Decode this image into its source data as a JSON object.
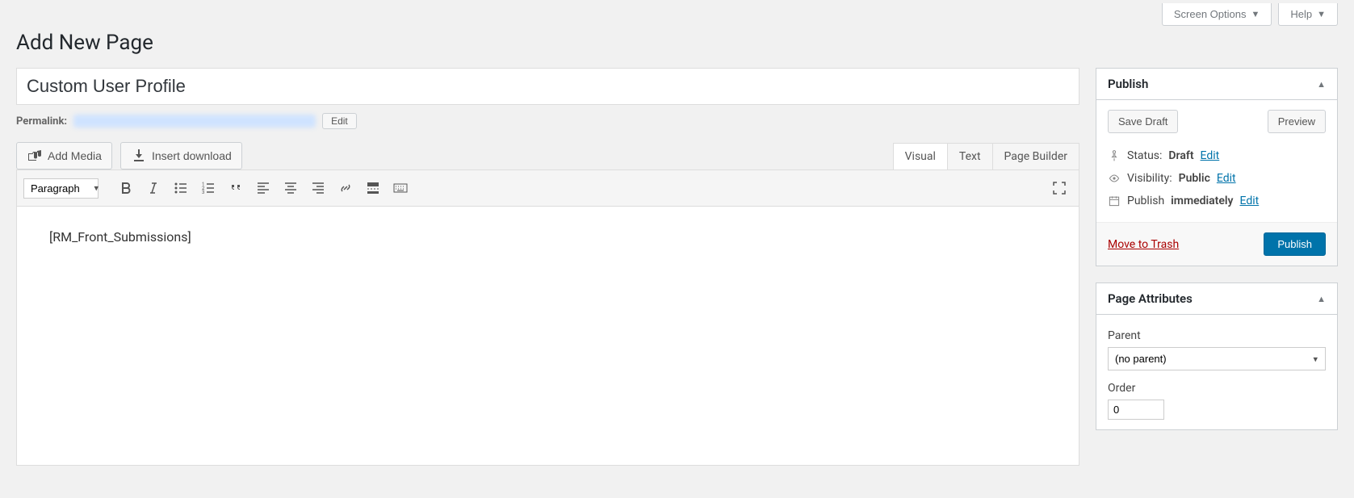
{
  "screen_options_label": "Screen Options",
  "help_label": "Help",
  "page_heading": "Add New Page",
  "title_value": "Custom User Profile",
  "permalink_label": "Permalink:",
  "permalink_edit": "Edit",
  "add_media_label": "Add Media",
  "insert_download_label": "Insert download",
  "tabs": {
    "visual": "Visual",
    "text": "Text",
    "page_builder": "Page Builder"
  },
  "format_option": "Paragraph",
  "editor_content": "[RM_Front_Submissions]",
  "publish_box": {
    "title": "Publish",
    "save_draft": "Save Draft",
    "preview": "Preview",
    "status_label": "Status:",
    "status_value": "Draft",
    "status_edit": "Edit",
    "visibility_label": "Visibility:",
    "visibility_value": "Public",
    "visibility_edit": "Edit",
    "publish_label": "Publish",
    "publish_value": "immediately",
    "publish_edit": "Edit",
    "move_to_trash": "Move to Trash",
    "publish_button": "Publish"
  },
  "attributes_box": {
    "title": "Page Attributes",
    "parent_label": "Parent",
    "parent_value": "(no parent)",
    "order_label": "Order",
    "order_value": "0"
  }
}
